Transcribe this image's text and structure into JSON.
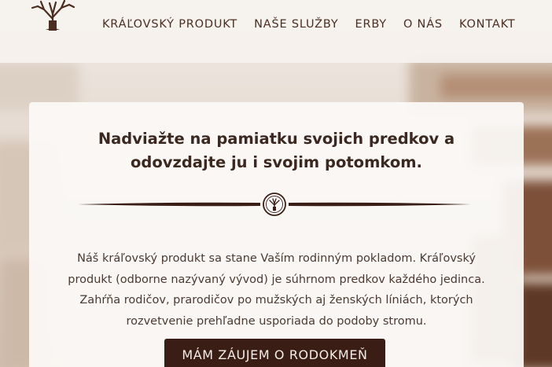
{
  "nav": {
    "items": [
      {
        "label": "KRÁĽOVSKÝ PRODUKT"
      },
      {
        "label": "NAŠE SLUŽBY"
      },
      {
        "label": "ERBY"
      },
      {
        "label": "O NÁS"
      },
      {
        "label": "KONTAKT"
      }
    ]
  },
  "logo": {
    "icon": "tree-icon"
  },
  "hero": {
    "headline_line1": "Nadviažte na pamiatku svojich predkov a",
    "headline_line2": "odovzdajte ju i svojim potomkom.",
    "divider_icon": "tree-medallion-icon",
    "body_lines": [
      "Náš kráľovský produkt sa stane Vaším rodinným pokladom. Kráľovský",
      "produkt (odborne nazývaný vývod) je súhrnom predkov každého jedinca.",
      "Zahŕňa rodičov, prarodičov po mužských aj ženských líniách, ktorých",
      "rozvetvenie prehľadne usporiada do podoby stromu."
    ],
    "cta_label": "MÁM ZÁUJEM O RODOKMEŇ"
  },
  "colors": {
    "brand_dark": "#3a1e16",
    "text_dark": "#3b2820",
    "header_bg": "#f6f2ee"
  }
}
